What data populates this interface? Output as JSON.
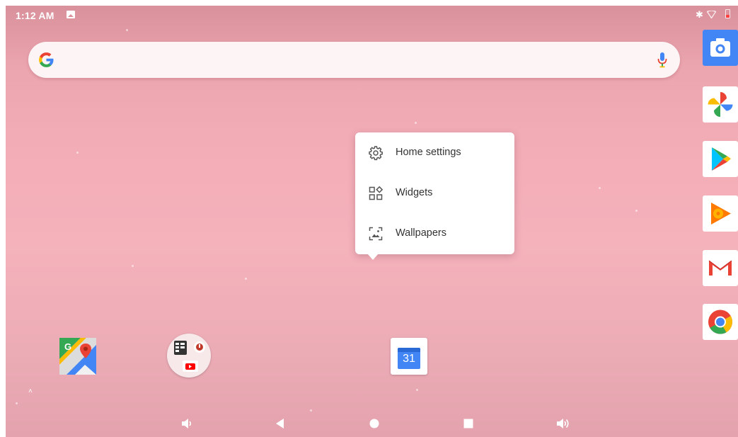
{
  "status_bar": {
    "time": "1:12 AM",
    "icons": [
      "image-notification-icon",
      "bluetooth-icon",
      "wifi-icon",
      "battery-low-icon"
    ]
  },
  "search_bar": {
    "icons": [
      "google-g-icon",
      "mic-icon"
    ]
  },
  "popup_menu": {
    "items": [
      {
        "label": "Home settings",
        "icon": "gear-icon"
      },
      {
        "label": "Widgets",
        "icon": "widgets-icon"
      },
      {
        "label": "Wallpapers",
        "icon": "wallpapers-icon"
      }
    ]
  },
  "home_icons": [
    {
      "name": "maps",
      "icon": "google-maps-icon"
    },
    {
      "name": "folder",
      "icon": "app-folder-icon"
    },
    {
      "name": "calendar",
      "icon": "calendar-icon",
      "day": "31"
    }
  ],
  "dock": [
    "camera-icon",
    "photos-icon",
    "play-store-icon",
    "play-music-icon",
    "gmail-icon",
    "chrome-icon"
  ],
  "nav_bar": [
    "volume-down-icon",
    "back-icon",
    "home-icon",
    "recents-icon",
    "volume-up-icon"
  ],
  "colors": {
    "wallpaper_top": "#d9919c",
    "wallpaper_mid": "#f5b2bb",
    "google_blue": "#4285f4",
    "google_red": "#ea4335",
    "google_yellow": "#fbbc05",
    "google_green": "#34a853"
  }
}
